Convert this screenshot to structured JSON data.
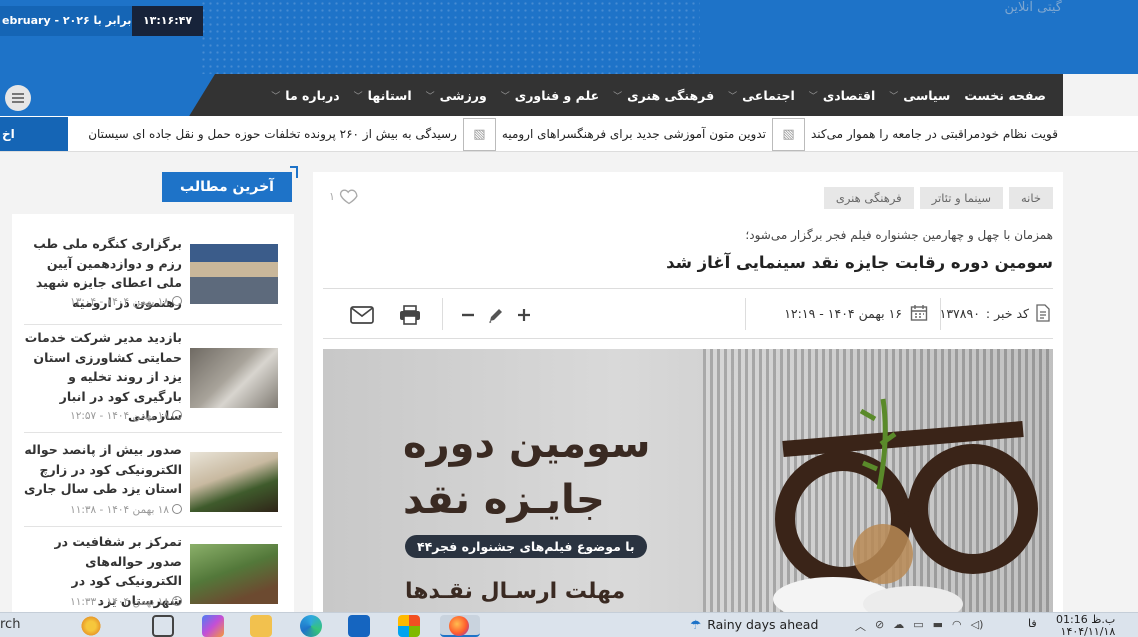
{
  "header": {
    "date_text": "ebruary - ۲۰۲۶ برابر با :",
    "time_text": "۱۳:۱۶:۴۷",
    "site_name": "گیتی آنلاین"
  },
  "nav": {
    "items": [
      {
        "label": "صفحه نخست",
        "chev": false
      },
      {
        "label": "سیاسی",
        "chev": true
      },
      {
        "label": "اقتصادی",
        "chev": true
      },
      {
        "label": "اجتماعی",
        "chev": true
      },
      {
        "label": "فرهنگی هنری",
        "chev": true
      },
      {
        "label": "علم و فناوری",
        "chev": true
      },
      {
        "label": "ورزشی",
        "chev": true
      },
      {
        "label": "استانها",
        "chev": true
      },
      {
        "label": "درباره ما",
        "chev": true
      }
    ]
  },
  "ticker": {
    "label": "اخ",
    "items": [
      "قویت نظام خودمراقبتی در جامعه را هموار می‌کند",
      "تدوین متون آموزشی جدید برای فرهنگسراهای ارومیه",
      "رسیدگی به بیش از ۲۶۰ پرونده تخلفات حوزه حمل و نقل جاده ای سیستان"
    ]
  },
  "sidebar": {
    "heading": "آخرین مطالب",
    "items": [
      {
        "title": "برگزاری کنگره ملی طب رزم و دوازدهمین آیین ملی اعطای جایزه شهید رهنمون در ارومیه",
        "time": "۱۸ بهمن ۱۴۰۴ - ۱۳:۰۴"
      },
      {
        "title": "بازدید مدیر شرکت خدمات حمایتی کشاورزی استان یزد از روند تخلیه و بارگیری کود در انبار سازمانی",
        "time": "۱۸ بهمن ۱۴۰۴ - ۱۲:۵۷"
      },
      {
        "title": "صدور بیش از پانصد حواله الکترونیکی کود در زارچ استان یزد طی سال جاری",
        "time": "۱۸ بهمن ۱۴۰۴ - ۱۱:۳۸"
      },
      {
        "title": "تمرکز بر شفافیت در صدور حواله‌های الکترونیکی کود در شهرستان یزد",
        "time": "۱۸ بهمن ۱۴۰۴ - ۱۱:۳۳"
      }
    ]
  },
  "article": {
    "crumbs": [
      "خانه",
      "سینما و تئاتر",
      "فرهنگی هنری"
    ],
    "likes": "۱",
    "lead": "همزمان با چهل و چهارمین جشنواره فیلم فجر برگزار می‌شود؛",
    "headline": "سومین دوره رقابت جایزه نقد سینمایی آغاز شد",
    "code_label": "کد خبر :",
    "code_value": "۱۳۷۸۹۰",
    "datetime": "۱۶ بهمن ۱۴۰۴ - ۱۲:۱۹",
    "hero": {
      "line1": "سومین دوره",
      "line2": "جایـزه نقد",
      "pill": "با موضوع فیلم‌های جشنواره فجر۴۴",
      "line3": "مهلت ارسـال نقـدها"
    }
  },
  "taskbar": {
    "search_text": "rch",
    "weather": "Rainy days ahead",
    "lang": "فا",
    "time": "01:16 ب.ظ",
    "date": "۱۴۰۴/۱۱/۱۸"
  }
}
